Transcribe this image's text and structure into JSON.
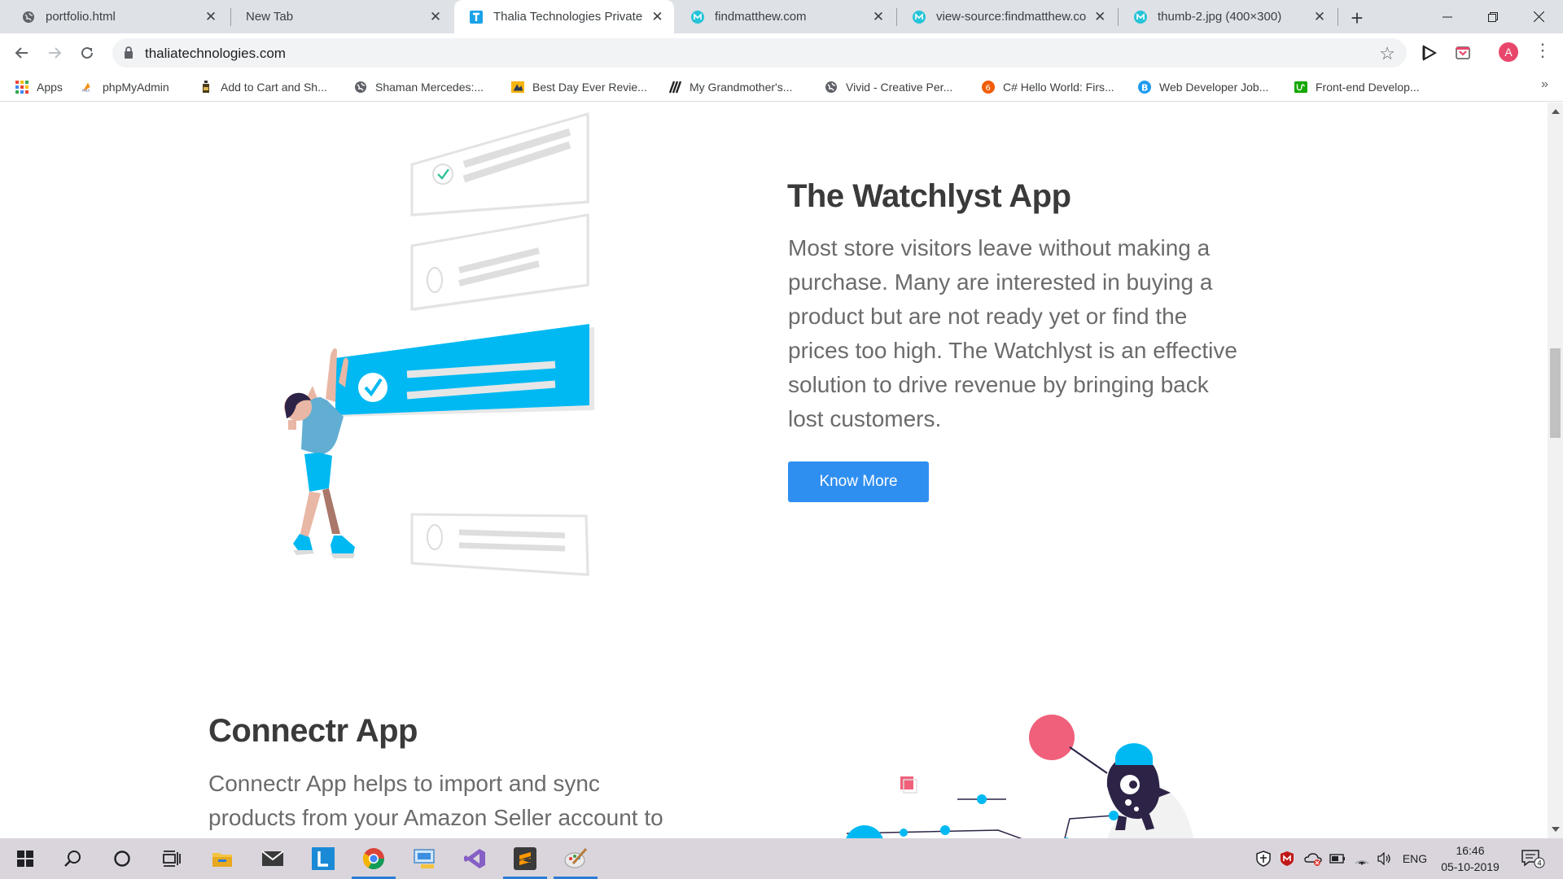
{
  "browser": {
    "tabs": [
      {
        "title": "portfolio.html",
        "icon": "globe-icon",
        "active": false
      },
      {
        "title": "New Tab",
        "icon": "none",
        "active": false
      },
      {
        "title": "Thalia Technologies Private L",
        "icon": "thalia-icon",
        "active": true
      },
      {
        "title": "findmatthew.com",
        "icon": "findmatthew-icon",
        "active": false
      },
      {
        "title": "view-source:findmatthew.cor",
        "icon": "findmatthew-icon",
        "active": false
      },
      {
        "title": "thumb-2.jpg (400×300)",
        "icon": "findmatthew-icon",
        "active": false
      }
    ],
    "url": "thaliatechnologies.com",
    "avatar_letter": "A",
    "bookmarks": [
      {
        "label": "Apps",
        "icon": "apps-grid-icon"
      },
      {
        "label": "phpMyAdmin",
        "icon": "phpmyadmin-icon"
      },
      {
        "label": "Add to Cart and Sh...",
        "icon": "bottle-icon"
      },
      {
        "label": "Shaman Mercedes:...",
        "icon": "globe-icon"
      },
      {
        "label": "Best Day Ever Revie...",
        "icon": "review-icon"
      },
      {
        "label": "My Grandmother's...",
        "icon": "claw-icon"
      },
      {
        "label": "Vivid - Creative Per...",
        "icon": "globe-icon"
      },
      {
        "label": "C# Hello World: Firs...",
        "icon": "csharp-icon"
      },
      {
        "label": "Web Developer Job...",
        "icon": "b-icon"
      },
      {
        "label": "Front-end Develop...",
        "icon": "upwork-icon"
      }
    ],
    "accent": "#1a73e8"
  },
  "page": {
    "watchlyst": {
      "title": "The Watchlyst App",
      "lines": [
        "Most store visitors leave without making a",
        "purchase. Many are interested in buying a",
        "product but are not ready yet or find the",
        "prices too high. The Watchlyst is an effective",
        "solution to drive revenue by bringing back",
        "lost customers."
      ],
      "button": "Know More"
    },
    "connectr": {
      "title": "Connectr App",
      "lines": [
        "Connectr App helps to import and sync",
        "products from your Amazon Seller account to"
      ]
    },
    "colors": {
      "heading": "#3a3a3a",
      "body": "#6b6b6b",
      "button": "#2f8ff0",
      "illustration_blue": "#00b9f2",
      "illustration_pink": "#f0607a"
    }
  },
  "taskbar": {
    "apps": [
      "windows-start-icon",
      "search-icon",
      "cortana-icon",
      "task-view-icon",
      "file-explorer-icon",
      "mail-icon",
      "l-app-icon",
      "chrome-icon",
      "control-panel-icon",
      "visual-studio-icon",
      "sublime-text-icon",
      "paint-icon"
    ],
    "language": "ENG",
    "time": "16:46",
    "date": "05-10-2019",
    "notification_count": "4"
  }
}
